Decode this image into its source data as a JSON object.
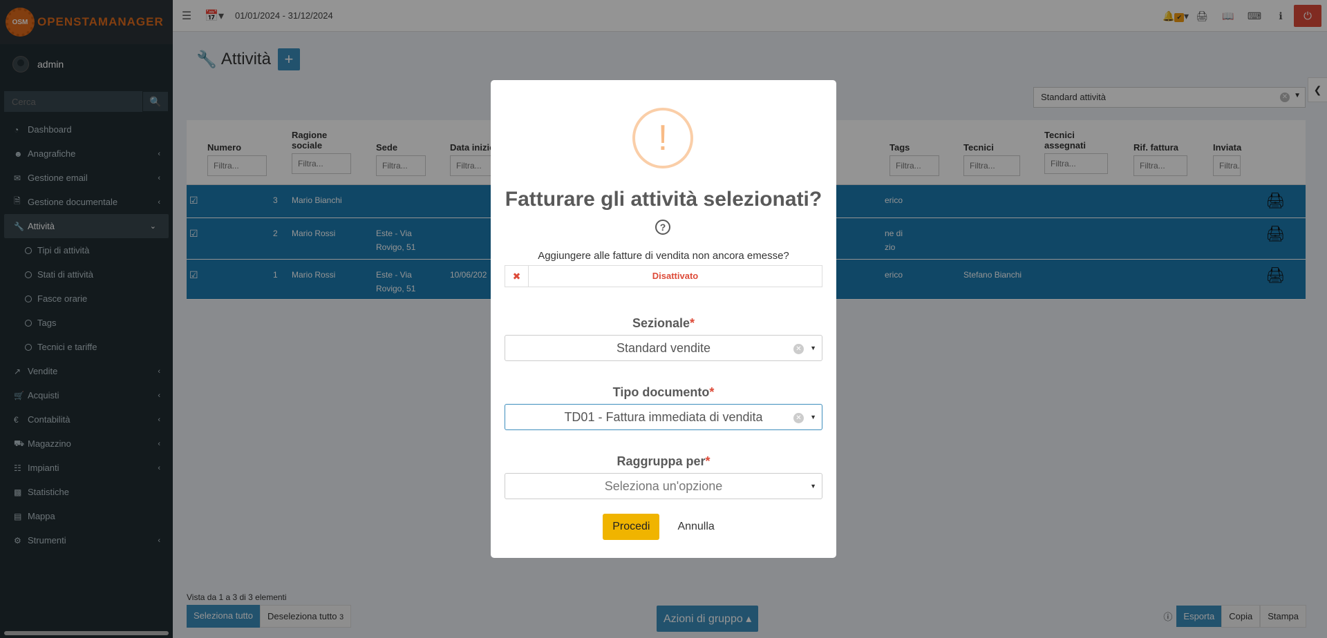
{
  "app": {
    "logo_short": "OSM",
    "logo_text": "OPENSTAMANAGER"
  },
  "user": {
    "name": "admin"
  },
  "sidebar": {
    "search_placeholder": "Cerca",
    "items": [
      {
        "label": "Dashboard",
        "icon": "dashboard-icon"
      },
      {
        "label": "Anagrafiche",
        "icon": "users-icon"
      },
      {
        "label": "Gestione email",
        "icon": "envelope-icon"
      },
      {
        "label": "Gestione documentale",
        "icon": "file-icon"
      },
      {
        "label": "Attività",
        "icon": "wrench-icon"
      },
      {
        "label": "Tipi di attività"
      },
      {
        "label": "Stati di attività"
      },
      {
        "label": "Fasce orarie"
      },
      {
        "label": "Tags"
      },
      {
        "label": "Tecnici e tariffe"
      },
      {
        "label": "Vendite",
        "icon": "chart-icon"
      },
      {
        "label": "Acquisti",
        "icon": "cart-icon"
      },
      {
        "label": "Contabilità",
        "icon": "euro-icon"
      },
      {
        "label": "Magazzino",
        "icon": "truck-icon"
      },
      {
        "label": "Impianti",
        "icon": "sitemap-icon"
      },
      {
        "label": "Statistiche",
        "icon": "bar-chart-icon"
      },
      {
        "label": "Mappa",
        "icon": "map-icon"
      },
      {
        "label": "Strumenti",
        "icon": "cog-icon"
      }
    ]
  },
  "topbar": {
    "period": "01/01/2024 - 31/12/2024"
  },
  "page": {
    "title": "Attività",
    "segment": "Standard attività"
  },
  "table": {
    "headers": {
      "numero": "Numero",
      "ragione": "Ragione sociale",
      "sede": "Sede",
      "data": "Data inizio",
      "tags": "Tags",
      "tecnici": "Tecnici",
      "tecnici_assegnati": "Tecnici assegnati",
      "rif_fattura": "Rif. fattura",
      "inviata": "Inviata"
    },
    "filter_placeholder": "Filtra...",
    "rows": [
      {
        "numero": "3",
        "ragione": "Mario Bianchi",
        "sede": "",
        "data": "",
        "partial": "erico",
        "tecnici": ""
      },
      {
        "numero": "2",
        "ragione": "Mario Rossi",
        "sede": "Este - Via Rovigo, 51",
        "data": "",
        "partial": "ne di zio",
        "tecnici": ""
      },
      {
        "numero": "1",
        "ragione": "Mario Rossi",
        "sede": "Este - Via Rovigo, 51",
        "data": "10/06/202",
        "partial": "erico",
        "tecnici": "Stefano Bianchi"
      }
    ]
  },
  "footer": {
    "info": "Vista da 1 a 3 di 3 elementi",
    "select_all": "Seleziona tutto",
    "deselect_all": "Deseleziona tutto",
    "selected_count": "3",
    "group_actions": "Azioni di gruppo",
    "export": "Esporta",
    "copy": "Copia",
    "print": "Stampa"
  },
  "modal": {
    "title": "Fatturare gli attività selezionati?",
    "add_label": "Aggiungere alle fatture di vendita non ancora emesse?",
    "toggle_value": "Disattivato",
    "sezionale_label": "Sezionale",
    "sezionale_value": "Standard vendite",
    "tipo_label": "Tipo documento",
    "tipo_value": "TD01 - Fattura immediata di vendita",
    "raggruppa_label": "Raggruppa per",
    "raggruppa_placeholder": "Seleziona un'opzione",
    "proceed": "Procedi",
    "cancel": "Annulla"
  },
  "colors": {
    "sidebar_bg": "#222d32",
    "primary": "#3c8dbc",
    "row_selected": "#1c7bb0",
    "warning": "#f0b400",
    "danger": "#dd4b39"
  }
}
